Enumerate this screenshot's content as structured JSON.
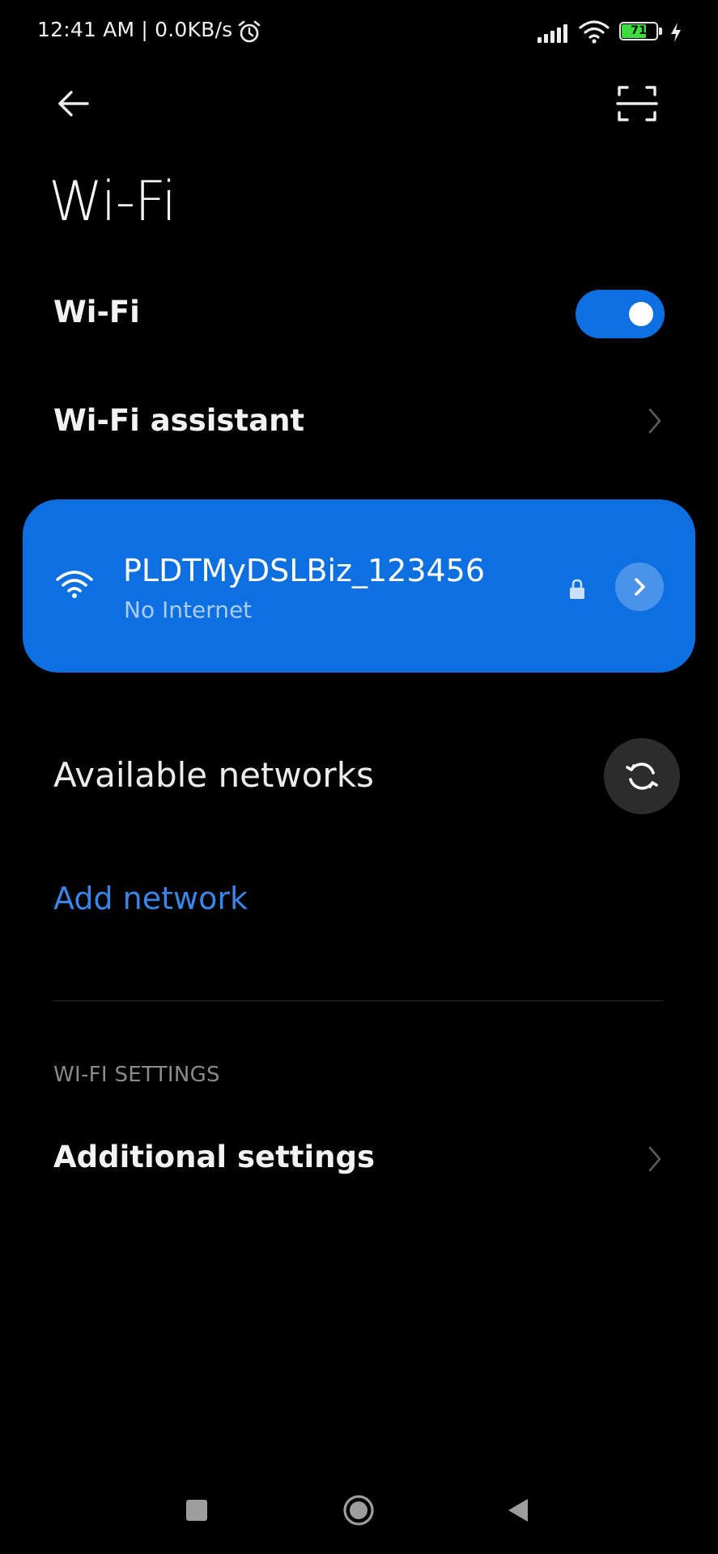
{
  "status_bar": {
    "time_speed": "12:41 AM | 0.0KB/s",
    "battery_level": "71",
    "battery_fraction": 0.71,
    "alarm_icon": "alarm-clock-icon",
    "signal_icon": "cellular-signal-icon",
    "wifi_icon": "wifi-icon",
    "charging_icon": "lightning-bolt-icon"
  },
  "header": {
    "back_icon": "arrow-left-icon",
    "scan_icon": "qr-scan-icon",
    "title": "Wi-Fi"
  },
  "wifi_toggle": {
    "label": "Wi-Fi",
    "enabled": true
  },
  "wifi_assistant": {
    "label": "Wi-Fi assistant"
  },
  "connected_network": {
    "ssid": "PLDTMyDSLBiz_123456",
    "status": "No Internet",
    "secured": true
  },
  "available_networks": {
    "heading": "Available networks",
    "refresh_icon": "refresh-icon"
  },
  "add_network": {
    "label": "Add network"
  },
  "settings_section": {
    "caption": "WI-FI SETTINGS",
    "items": [
      {
        "label": "Additional settings"
      }
    ]
  },
  "navigation": {
    "recents_icon": "square-icon",
    "home_icon": "circle-icon",
    "back_icon": "triangle-back-icon"
  },
  "colors": {
    "background": "#000000",
    "accent": "#0d6fe0",
    "link": "#3a86e8",
    "battery": "#3ddc3d"
  }
}
